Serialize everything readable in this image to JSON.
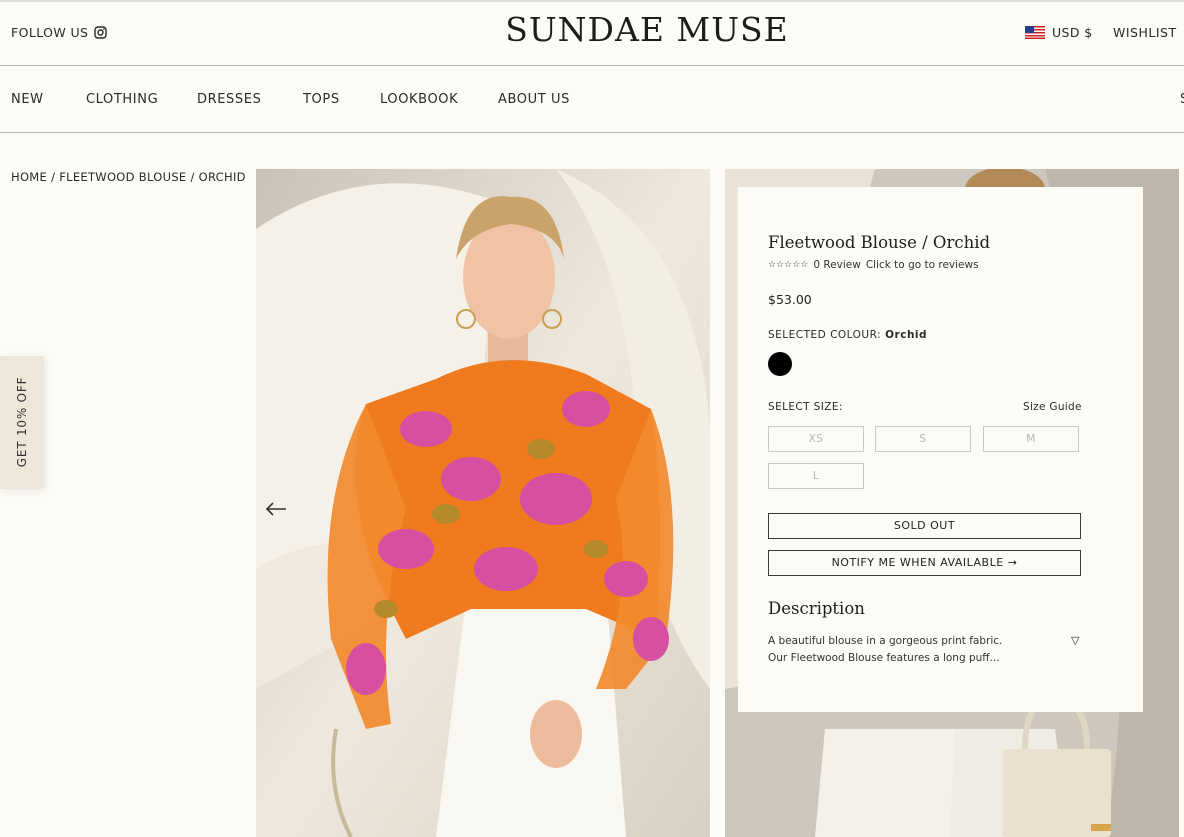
{
  "header": {
    "follow_label": "FOLLOW US",
    "logo": "SUNDAE MUSE",
    "currency": "USD $",
    "wishlist": "WISHLIST"
  },
  "nav": {
    "items": [
      "NEW",
      "CLOTHING",
      "DRESSES",
      "TOPS",
      "LOOKBOOK",
      "ABOUT US"
    ],
    "cut_item": "S"
  },
  "breadcrumb": {
    "home": "HOME",
    "product": "FLEETWOOD BLOUSE",
    "colour": "ORCHID"
  },
  "promo_tab": "GET 10% OFF",
  "product": {
    "title": "Fleetwood Blouse / Orchid",
    "reviews": "0 Review",
    "reviews_link": "Click to go to reviews",
    "price": "$53.00",
    "selected_colour_label": "SELECTED COLOUR:",
    "selected_colour": "Orchid",
    "swatch_color": "#000000",
    "select_size_label": "SELECT SIZE:",
    "size_guide": "Size Guide",
    "sizes": [
      "XS",
      "S",
      "M",
      "L"
    ],
    "sold_out": "SOLD OUT",
    "notify": "NOTIFY ME WHEN AVAILABLE",
    "description_heading": "Description",
    "description_line1": "A beautiful blouse in a gorgeous print fabric.",
    "description_line2": "Our Fleetwood Blouse features a long puff..."
  },
  "colors": {
    "background": "#fdfbf6",
    "blouse_orange": "#f07a1e",
    "blouse_pink": "#d64fa0",
    "promo_bg": "#eee6d9"
  }
}
